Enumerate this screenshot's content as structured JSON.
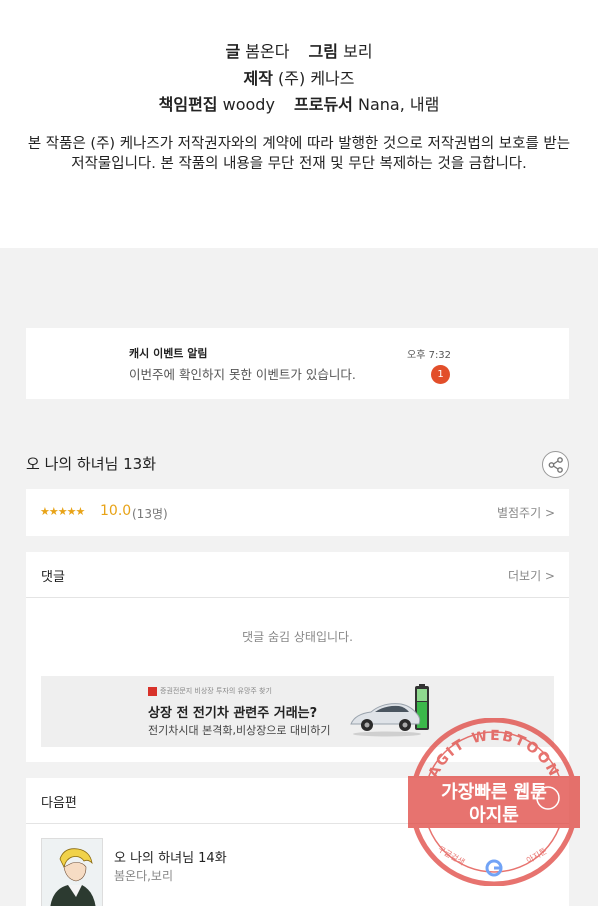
{
  "credits": {
    "writer_label": "글",
    "writer": "봄온다",
    "artist_label": "그림",
    "artist": "보리",
    "production_label": "제작",
    "production": "(주) 케나즈",
    "editor_label": "책임편집",
    "editor": "woody",
    "producer_label": "프로듀서",
    "producer": "Nana, 내램",
    "copyright": "본 작품은 (주) 케나즈가 저작권자와의 계약에 따라 발행한 것으로 저작권법의 보호를 받는 저작물입니다. 본 작품의 내용을 무단 전재 및 무단 복제하는 것을 금합니다."
  },
  "notification": {
    "title": "캐시 이벤트 알림",
    "message": "이번주에 확인하지 못한 이벤트가 있습니다.",
    "time": "오후 7:32",
    "badge": "1"
  },
  "episode": {
    "title": "오 나의 하녀님 13화",
    "share_icon": "share-icon"
  },
  "rating": {
    "stars": "★★★★★",
    "score": "10.0",
    "count": "(13명)",
    "rate_link": "별점주기 >",
    "accent_color": "#e8a317"
  },
  "comments": {
    "header": "댓글",
    "more_link": "더보기 >",
    "hidden_message": "댓글 숨김 상태입니다."
  },
  "ad": {
    "source": "증권전문지 비상장 투자의 유망주 찾기",
    "title": "상장 전 전기차 관련주 거래는?",
    "subtitle": "전기차시대 본격화,비상장으로 대비하기"
  },
  "next_episode": {
    "header": "다음편",
    "title": "오 나의 하녀님 14화",
    "authors": "봄온다,보리"
  },
  "watermark": {
    "top_text": "AGIT WEBTOON",
    "line1": "가장빠른 웹툰",
    "line2": "아지툰",
    "bottom_left": "구글검색",
    "bottom_right": "아지툰",
    "color": "#e0453f"
  }
}
